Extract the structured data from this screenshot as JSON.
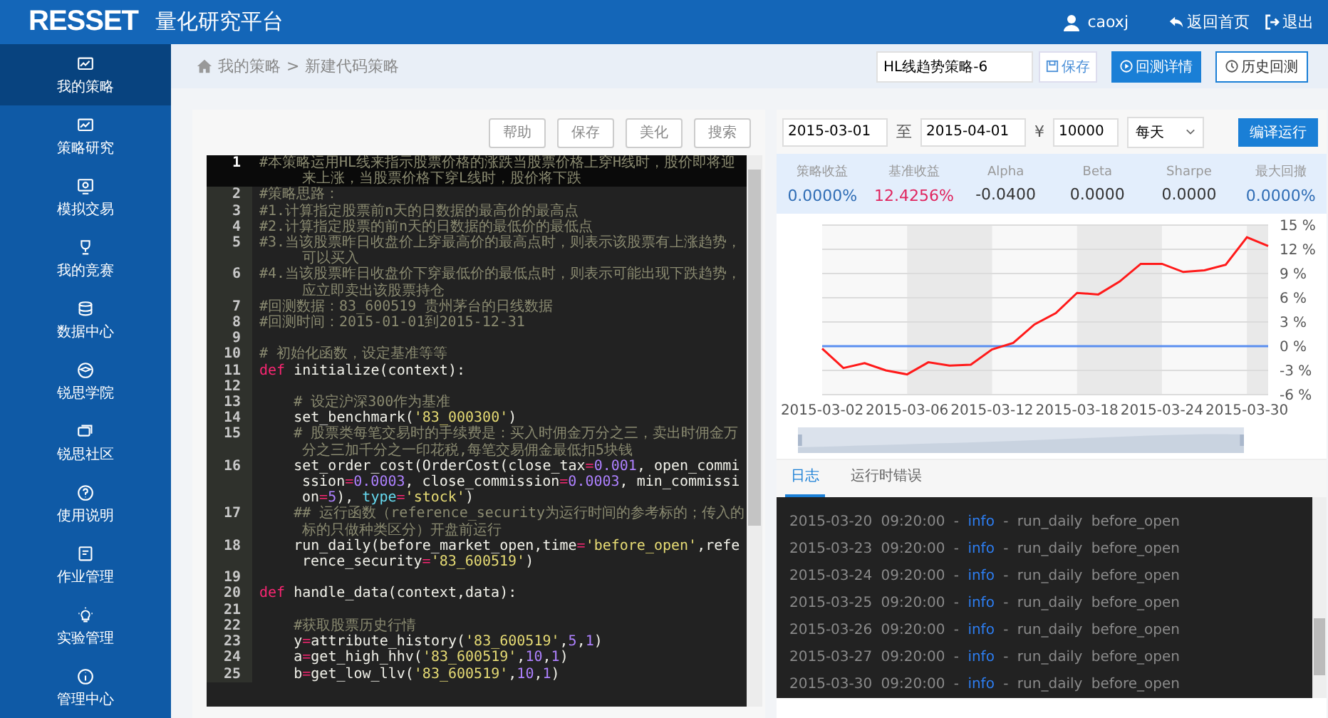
{
  "header": {
    "logo": "RESSET",
    "title": "量化研究平台",
    "user": "caoxj",
    "home_link": "返回首页",
    "logout_link": "退出"
  },
  "sidebar": {
    "items": [
      {
        "label": "我的策略",
        "selected": true
      },
      {
        "label": "策略研究",
        "selected": false
      },
      {
        "label": "模拟交易",
        "selected": false
      },
      {
        "label": "我的竞赛",
        "selected": false
      },
      {
        "label": "数据中心",
        "selected": false
      },
      {
        "label": "锐思学院",
        "selected": false
      },
      {
        "label": "锐思社区",
        "selected": false
      },
      {
        "label": "使用说明",
        "selected": false
      },
      {
        "label": "作业管理",
        "selected": false
      },
      {
        "label": "实验管理",
        "selected": false
      },
      {
        "label": "管理中心",
        "selected": false
      }
    ]
  },
  "breadcrumb": {
    "items": [
      "我的策略",
      "新建代码策略"
    ],
    "separator": ">"
  },
  "strategy_bar": {
    "name_value": "HL线趋势策略-6",
    "save": "保存",
    "detail": "回测详情",
    "history": "历史回测"
  },
  "editor": {
    "buttons": [
      "帮助",
      "保存",
      "美化",
      "搜索"
    ],
    "lines": [
      {
        "num": "1",
        "current": true,
        "tokens": [
          {
            "kind": "comment",
            "text": "#本策略运用HL线来指示股票价格的涨跌当股票价格上穿H线时，股价即将迎来上涨，当股票价格下穿L线时，股价将下跌"
          }
        ]
      },
      {
        "num": "2",
        "current": false,
        "tokens": [
          {
            "kind": "comment",
            "text": "#策略思路："
          }
        ]
      },
      {
        "num": "3",
        "current": false,
        "tokens": [
          {
            "kind": "comment",
            "text": "#1.计算指定股票前n天的日数据的最高价的最高点"
          }
        ]
      },
      {
        "num": "4",
        "current": false,
        "tokens": [
          {
            "kind": "comment",
            "text": "#2.计算指定股票的前n天的日数据的最低价的最低点"
          }
        ]
      },
      {
        "num": "5",
        "current": false,
        "tokens": [
          {
            "kind": "comment",
            "text": "#3.当该股票昨日收盘价上穿最高价的最高点时，则表示该股票有上涨趋势，可以买入"
          }
        ]
      },
      {
        "num": "6",
        "current": false,
        "tokens": [
          {
            "kind": "comment",
            "text": "#4.当该股票昨日收盘价下穿最低价的最低点时，则表示可能出现下跌趋势，应立即卖出该股票持仓"
          }
        ]
      },
      {
        "num": "7",
        "current": false,
        "tokens": [
          {
            "kind": "comment",
            "text": "#回测数据：83_600519 贵州茅台的日线数据"
          }
        ]
      },
      {
        "num": "8",
        "current": false,
        "tokens": [
          {
            "kind": "comment",
            "text": "#回测时间：2015-01-01到2015-12-31"
          }
        ]
      },
      {
        "num": "9",
        "current": false
      },
      {
        "num": "10",
        "current": false,
        "tokens": [
          {
            "kind": "comment",
            "text": "# 初始化函数，设定基准等等"
          }
        ]
      },
      {
        "num": "11",
        "current": false,
        "tokens": [
          {
            "kind": "keyword",
            "text": "def"
          },
          {
            "kind": "plain",
            "text": " initialize(context):"
          }
        ]
      },
      {
        "num": "12",
        "current": false
      },
      {
        "num": "13",
        "current": false,
        "tokens": [
          {
            "kind": "comment",
            "text": "    # 设定沪深300作为基准"
          }
        ]
      },
      {
        "num": "14",
        "current": false,
        "tokens": [
          {
            "kind": "plain",
            "text": "    set_benchmark("
          },
          {
            "kind": "string",
            "text": "'83_000300'"
          },
          {
            "kind": "plain",
            "text": ")"
          }
        ]
      },
      {
        "num": "15",
        "current": false,
        "tokens": [
          {
            "kind": "comment",
            "text": "    # 股票类每笔交易时的手续费是：买入时佣金万分之三，卖出时佣金万分之三加千分之一印花税,每笔交易佣金最低扣5块钱"
          }
        ]
      },
      {
        "num": "16",
        "current": false,
        "tokens": [
          {
            "kind": "plain",
            "text": "    set_order_cost(OrderCost(close_tax"
          },
          {
            "kind": "operator",
            "text": "="
          },
          {
            "kind": "number",
            "text": "0.001"
          },
          {
            "kind": "plain",
            "text": ", open_commission"
          },
          {
            "kind": "operator",
            "text": "="
          },
          {
            "kind": "number",
            "text": "0.0003"
          },
          {
            "kind": "plain",
            "text": ", close_commission"
          },
          {
            "kind": "operator",
            "text": "="
          },
          {
            "kind": "number",
            "text": "0.0003"
          },
          {
            "kind": "plain",
            "text": ", min_commission"
          },
          {
            "kind": "operator",
            "text": "="
          },
          {
            "kind": "number",
            "text": "5"
          },
          {
            "kind": "plain",
            "text": "), "
          },
          {
            "kind": "param",
            "text": "type"
          },
          {
            "kind": "operator",
            "text": "="
          },
          {
            "kind": "string",
            "text": "'stock'"
          },
          {
            "kind": "plain",
            "text": ")"
          }
        ]
      },
      {
        "num": "17",
        "current": false,
        "tokens": [
          {
            "kind": "comment",
            "text": "    ## 运行函数（reference_security为运行时间的参考标的；传入的标的只做种类区分）开盘前运行"
          }
        ]
      },
      {
        "num": "18",
        "current": false,
        "tokens": [
          {
            "kind": "plain",
            "text": "    run_daily(before_market_open,time"
          },
          {
            "kind": "operator",
            "text": "="
          },
          {
            "kind": "string",
            "text": "'before_open'"
          },
          {
            "kind": "plain",
            "text": ",reference_security"
          },
          {
            "kind": "operator",
            "text": "="
          },
          {
            "kind": "string",
            "text": "'83_600519'"
          },
          {
            "kind": "plain",
            "text": ")"
          }
        ]
      },
      {
        "num": "19",
        "current": false
      },
      {
        "num": "20",
        "current": false,
        "tokens": [
          {
            "kind": "keyword",
            "text": "def"
          },
          {
            "kind": "plain",
            "text": " handle_data(context,data):"
          }
        ]
      },
      {
        "num": "21",
        "current": false
      },
      {
        "num": "22",
        "current": false,
        "tokens": [
          {
            "kind": "comment",
            "text": "    #获取股票历史行情"
          }
        ]
      },
      {
        "num": "23",
        "current": false,
        "tokens": [
          {
            "kind": "plain",
            "text": "    y"
          },
          {
            "kind": "operator",
            "text": "="
          },
          {
            "kind": "plain",
            "text": "attribute_history("
          },
          {
            "kind": "string",
            "text": "'83_600519'"
          },
          {
            "kind": "plain",
            "text": ","
          },
          {
            "kind": "number",
            "text": "5"
          },
          {
            "kind": "plain",
            "text": ","
          },
          {
            "kind": "number",
            "text": "1"
          },
          {
            "kind": "plain",
            "text": ")"
          }
        ]
      },
      {
        "num": "24",
        "current": false,
        "tokens": [
          {
            "kind": "plain",
            "text": "    a"
          },
          {
            "kind": "operator",
            "text": "="
          },
          {
            "kind": "plain",
            "text": "get_high_hhv("
          },
          {
            "kind": "string",
            "text": "'83_600519'"
          },
          {
            "kind": "plain",
            "text": ","
          },
          {
            "kind": "number",
            "text": "10"
          },
          {
            "kind": "plain",
            "text": ","
          },
          {
            "kind": "number",
            "text": "1"
          },
          {
            "kind": "plain",
            "text": ")"
          }
        ]
      },
      {
        "num": "25",
        "current": false,
        "tokens": [
          {
            "kind": "plain",
            "text": "    b"
          },
          {
            "kind": "operator",
            "text": "="
          },
          {
            "kind": "plain",
            "text": "get_low_llv("
          },
          {
            "kind": "string",
            "text": "'83_600519'"
          },
          {
            "kind": "plain",
            "text": ","
          },
          {
            "kind": "number",
            "text": "10"
          },
          {
            "kind": "plain",
            "text": ","
          },
          {
            "kind": "number",
            "text": "1"
          },
          {
            "kind": "plain",
            "text": ")"
          }
        ]
      }
    ]
  },
  "backtest": {
    "start_date": "2015-03-01",
    "to_label": "至",
    "end_date": "2015-04-01",
    "currency": "¥",
    "capital": "10000",
    "frequency": "每天",
    "run_button": "编译运行",
    "stats": [
      {
        "label": "策略收益",
        "value": "0.0000%",
        "color": "#2f6db5"
      },
      {
        "label": "基准收益",
        "value": "12.4256%",
        "color": "#e0245e"
      },
      {
        "label": "Alpha",
        "value": "-0.0400",
        "color": "#333333"
      },
      {
        "label": "Beta",
        "value": "0.0000",
        "color": "#333333"
      },
      {
        "label": "Sharpe",
        "value": "0.0000",
        "color": "#333333"
      },
      {
        "label": "最大回撤",
        "value": "0.0000%",
        "color": "#2f6db5"
      }
    ],
    "chart_data": {
      "type": "line",
      "grid": true,
      "categories": [
        "2015-03-02",
        null,
        null,
        null,
        "2015-03-06",
        null,
        null,
        null,
        "2015-03-12",
        null,
        null,
        null,
        "2015-03-18",
        null,
        null,
        null,
        "2015-03-24",
        null,
        null,
        null,
        "2015-03-30",
        null
      ],
      "ylim": [
        -6,
        15
      ],
      "yticks": [
        {
          "value": 15,
          "label": "15 %"
        },
        {
          "value": 12,
          "label": "12 %"
        },
        {
          "value": 9,
          "label": "9 %"
        },
        {
          "value": 6,
          "label": "6 %"
        },
        {
          "value": 3,
          "label": "3 %"
        },
        {
          "value": 0,
          "label": "0 %"
        },
        {
          "value": -3,
          "label": "-3 %"
        },
        {
          "value": -6,
          "label": "-6 %"
        }
      ],
      "series": [
        {
          "color": "#ff1a1a",
          "values": [
            -0.3,
            -2.7,
            -2.1,
            -3.0,
            -3.5,
            -2.0,
            -2.4,
            -2.3,
            -0.4,
            0.4,
            2.7,
            4.1,
            6.6,
            6.4,
            8.0,
            10.2,
            10.2,
            9.2,
            9.4,
            10.1,
            13.5,
            12.4
          ]
        },
        {
          "color": "#5b8ff0",
          "values": [
            0,
            0,
            0,
            0,
            0,
            0,
            0,
            0,
            0,
            0,
            0,
            0,
            0,
            0,
            0,
            0,
            0,
            0,
            0,
            0,
            0,
            0
          ]
        }
      ]
    },
    "log_tabs": [
      {
        "label": "日志",
        "selected": true
      },
      {
        "label": "运行时错误",
        "selected": false
      }
    ],
    "log": [
      {
        "time": "2015-03-20 09:20:00 -",
        "level": "info",
        "message": "- run_daily before_open"
      },
      {
        "time": "2015-03-23 09:20:00 -",
        "level": "info",
        "message": "- run_daily before_open"
      },
      {
        "time": "2015-03-24 09:20:00 -",
        "level": "info",
        "message": "- run_daily before_open"
      },
      {
        "time": "2015-03-25 09:20:00 -",
        "level": "info",
        "message": "- run_daily before_open"
      },
      {
        "time": "2015-03-26 09:20:00 -",
        "level": "info",
        "message": "- run_daily before_open"
      },
      {
        "time": "2015-03-27 09:20:00 -",
        "level": "info",
        "message": "- run_daily before_open"
      },
      {
        "time": "2015-03-30 09:20:00 -",
        "level": "info",
        "message": "- run_daily before_open"
      }
    ]
  }
}
